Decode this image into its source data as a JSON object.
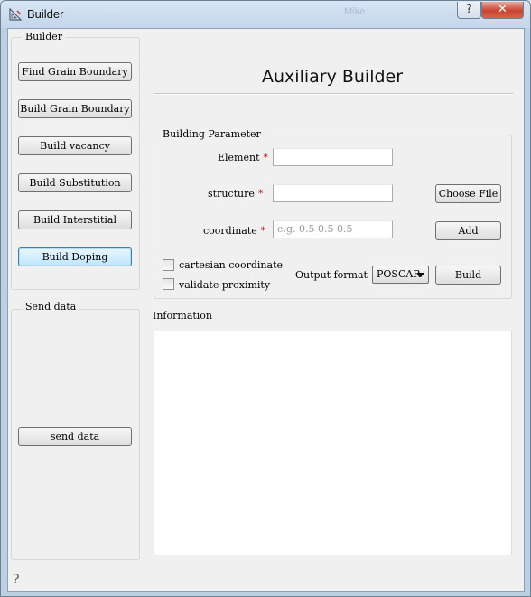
{
  "window": {
    "title": "Builder",
    "background_window_title": "Mike"
  },
  "titlebar": {
    "help_label": "?",
    "close_label": "✕"
  },
  "left_panel": {
    "builder_group_title": "Builder",
    "buttons": [
      {
        "label": "Find Grain Boundary"
      },
      {
        "label": "Build Grain Boundary"
      },
      {
        "label": "Build vacancy"
      },
      {
        "label": "Build Substitution"
      },
      {
        "label": "Build Interstitial"
      },
      {
        "label": "Build Doping"
      }
    ],
    "send_group_title": "Send data",
    "send_button_label": "send data"
  },
  "main": {
    "heading": "Auxiliary Builder",
    "params_group_title": "Building Parameter",
    "element_label": "Element",
    "structure_label": "structure",
    "coordinate_label": "coordinate",
    "required_mark": "*",
    "coordinate_placeholder": "e.g. 0.5 0.5 0.5",
    "choose_file_label": "Choose File",
    "add_label": "Add",
    "cartesian_label": "cartesian coordinate",
    "validate_label": "validate proximity",
    "output_format_label": "Output format",
    "output_format_value": "POSCAR",
    "build_label": "Build",
    "information_label": "Information"
  },
  "statusbar": {
    "help_icon_glyph": "?"
  },
  "colors": {
    "close_button": "#c8442e",
    "required_star": "#d00000",
    "focus_border": "#3c7fb1"
  }
}
